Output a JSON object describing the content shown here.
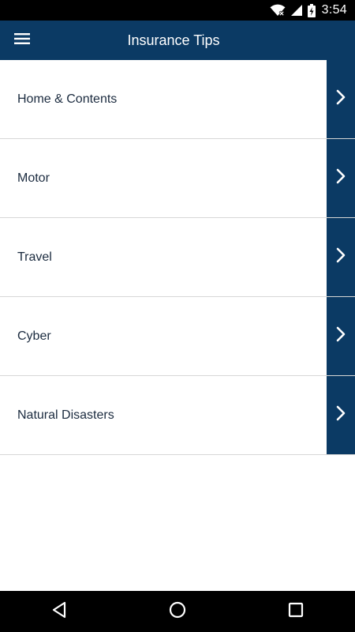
{
  "status_bar": {
    "time": "3:54",
    "icons": [
      "wifi-icon",
      "signal-icon",
      "battery-charging-icon"
    ]
  },
  "app_bar": {
    "title": "Insurance Tips",
    "menu_icon": "hamburger-menu-icon"
  },
  "list": {
    "items": [
      {
        "label": "Home & Contents"
      },
      {
        "label": "Motor"
      },
      {
        "label": "Travel"
      },
      {
        "label": "Cyber"
      },
      {
        "label": "Natural Disasters"
      }
    ],
    "chevron_icon": "chevron-right-icon"
  },
  "nav_bar": {
    "icons": [
      "back-icon",
      "home-icon",
      "recents-icon"
    ]
  },
  "colors": {
    "primary": "#0b3a64",
    "background": "#ffffff",
    "divider": "#d6d6d6",
    "text": "#1b2b3f",
    "system_bar": "#000000"
  }
}
